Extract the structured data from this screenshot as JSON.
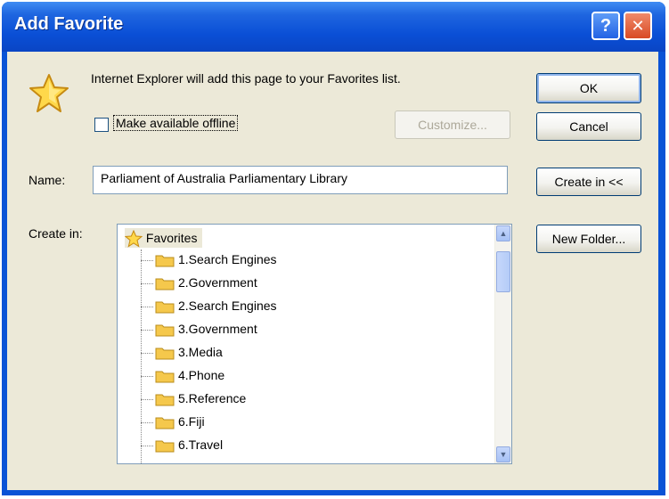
{
  "dialog": {
    "title": "Add Favorite",
    "help_symbol": "?",
    "close_symbol": "✕",
    "message": "Internet Explorer will add this page to your Favorites list."
  },
  "offline_option": {
    "label": "Make available offline",
    "checked": false
  },
  "buttons": {
    "ok": "OK",
    "cancel": "Cancel",
    "customize": "Customize...",
    "create_in": "Create in <<",
    "new_folder": "New Folder..."
  },
  "name_field": {
    "label": "Name:",
    "value": "Parliament of Australia Parliamentary Library"
  },
  "create_in": {
    "label": "Create in:",
    "root": "Favorites",
    "folders": [
      "1.Search Engines",
      "2.Government",
      "2.Search Engines",
      "3.Government",
      "3.Media",
      "4.Phone",
      "5.Reference",
      "6.Fiji",
      "6.Travel"
    ]
  },
  "icons": {
    "title_help": "help-icon",
    "title_close": "close-icon",
    "dialog_star": "favorites-star-icon",
    "tree_root": "favorites-star-icon",
    "tree_folder": "folder-icon"
  },
  "colors": {
    "titlebar": "#0a53d6",
    "dialog_face": "#ece9d8",
    "folder_yellow": "#f5c84c"
  }
}
